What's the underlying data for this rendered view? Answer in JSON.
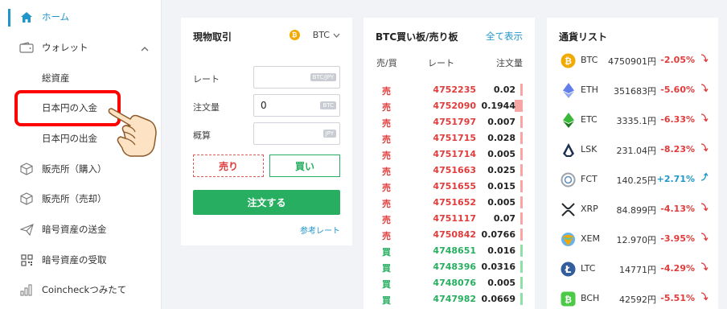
{
  "sidebar": {
    "items": [
      {
        "label": "ホーム",
        "icon": "home-icon"
      },
      {
        "label": "ウォレット",
        "icon": "wallet-icon"
      },
      {
        "label": "総資産",
        "icon": ""
      },
      {
        "label": "日本円の入金",
        "icon": ""
      },
      {
        "label": "日本円の出金",
        "icon": ""
      },
      {
        "label": "販売所（購入）",
        "icon": "cube-icon"
      },
      {
        "label": "販売所（売却）",
        "icon": "cube-icon"
      },
      {
        "label": "暗号資産の送金",
        "icon": "paper-plane-icon"
      },
      {
        "label": "暗号資産の受取",
        "icon": "qr-code-icon"
      },
      {
        "label": "Coincheckつみたて",
        "icon": "bar-chart-icon"
      }
    ]
  },
  "trade": {
    "title": "現物取引",
    "currency": "BTC",
    "rate_label": "レート",
    "rate_tag": "BTC/JPY",
    "amount_label": "注文量",
    "amount_value": "0",
    "amount_tag": "BTC",
    "estimate_label": "概算",
    "estimate_tag": "JPY",
    "sell_label": "売り",
    "buy_label": "買い",
    "order_label": "注文する",
    "ref_link": "参考レート"
  },
  "book": {
    "title": "BTC買い板/売り板",
    "show_all": "全て表示",
    "headers": {
      "side": "売/買",
      "rate": "レート",
      "qty": "注文量"
    },
    "rows": [
      {
        "side": "売",
        "rate": "4752235",
        "qty": "0.02",
        "type": "sell",
        "bar": 0.06
      },
      {
        "side": "売",
        "rate": "4752090",
        "qty": "0.1944",
        "type": "sell",
        "bar": 0.8
      },
      {
        "side": "売",
        "rate": "4751797",
        "qty": "0.007",
        "type": "sell",
        "bar": 0.04
      },
      {
        "side": "売",
        "rate": "4751715",
        "qty": "0.028",
        "type": "sell",
        "bar": 0.1
      },
      {
        "side": "売",
        "rate": "4751714",
        "qty": "0.005",
        "type": "sell",
        "bar": 0.04
      },
      {
        "side": "売",
        "rate": "4751663",
        "qty": "0.025",
        "type": "sell",
        "bar": 0.08
      },
      {
        "side": "売",
        "rate": "4751655",
        "qty": "0.015",
        "type": "sell",
        "bar": 0.06
      },
      {
        "side": "売",
        "rate": "4751652",
        "qty": "0.005",
        "type": "sell",
        "bar": 0.04
      },
      {
        "side": "売",
        "rate": "4751117",
        "qty": "0.07",
        "type": "sell",
        "bar": 0.25
      },
      {
        "side": "売",
        "rate": "4750842",
        "qty": "0.0766",
        "type": "sell",
        "bar": 0.28
      },
      {
        "side": "買",
        "rate": "4748651",
        "qty": "0.016",
        "type": "buy",
        "bar": 0.06
      },
      {
        "side": "買",
        "rate": "4748396",
        "qty": "0.0316",
        "type": "buy",
        "bar": 0.15
      },
      {
        "side": "買",
        "rate": "4748076",
        "qty": "0.005",
        "type": "buy",
        "bar": 0.04
      },
      {
        "side": "買",
        "rate": "4747982",
        "qty": "0.0669",
        "type": "buy",
        "bar": 0.25
      }
    ]
  },
  "coins": {
    "title": "通貨リスト",
    "rows": [
      {
        "symbol": "BTC",
        "price": "4750901円",
        "change": "-2.05%",
        "dir": "down",
        "icon": "bitcoin-icon",
        "color": "#f2a900"
      },
      {
        "symbol": "ETH",
        "price": "351683円",
        "change": "-5.60%",
        "dir": "down",
        "icon": "ethereum-icon",
        "color": "#627eea"
      },
      {
        "symbol": "ETC",
        "price": "3335.1円",
        "change": "-6.33%",
        "dir": "down",
        "icon": "ethereum-classic-icon",
        "color": "#3ab83a"
      },
      {
        "symbol": "LSK",
        "price": "231.04円",
        "change": "-8.23%",
        "dir": "down",
        "icon": "lisk-icon",
        "color": "#1a2f4f"
      },
      {
        "symbol": "FCT",
        "price": "140.25円",
        "change": "+2.71%",
        "dir": "up",
        "icon": "factom-icon",
        "color": "#9ca3ad"
      },
      {
        "symbol": "XRP",
        "price": "84.899円",
        "change": "-4.13%",
        "dir": "down",
        "icon": "ripple-icon",
        "color": "#23292f"
      },
      {
        "symbol": "XEM",
        "price": "12.970円",
        "change": "-3.95%",
        "dir": "down",
        "icon": "nem-icon",
        "color": "#67b2e8"
      },
      {
        "symbol": "LTC",
        "price": "14771円",
        "change": "-4.29%",
        "dir": "down",
        "icon": "litecoin-icon",
        "color": "#345d9d"
      },
      {
        "symbol": "BCH",
        "price": "42592円",
        "change": "-5.51%",
        "dir": "down",
        "icon": "bitcoin-cash-icon",
        "color": "#4cca47"
      }
    ]
  },
  "colors": {
    "accent": "#2196c9",
    "sell": "#e03c3c",
    "buy": "#27ae60",
    "highlight": "#ff0000"
  }
}
